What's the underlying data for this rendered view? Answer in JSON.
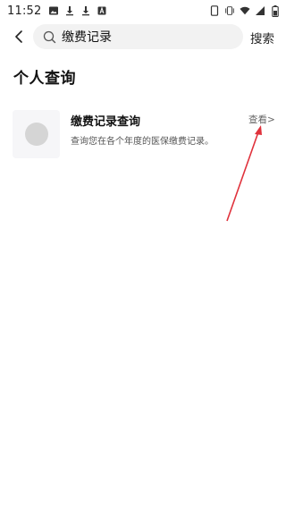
{
  "status_bar": {
    "time": "11:52",
    "left_icons": [
      "image-icon",
      "download-icon",
      "download-icon",
      "app-icon"
    ],
    "right_icons": [
      "phone-icon",
      "vibrate-icon",
      "wifi-icon",
      "signal-icon",
      "battery-icon"
    ]
  },
  "search": {
    "value": "缴费记录",
    "button_label": "搜索"
  },
  "section": {
    "title": "个人查询"
  },
  "result_card": {
    "title": "缴费记录查询",
    "description": "查询您在各个年度的医保缴费记录。",
    "link_label": "查看>"
  },
  "colors": {
    "annotation_arrow": "#e0323c",
    "search_bg": "#f2f2f2",
    "thumb_bg": "#f6f6f8"
  }
}
